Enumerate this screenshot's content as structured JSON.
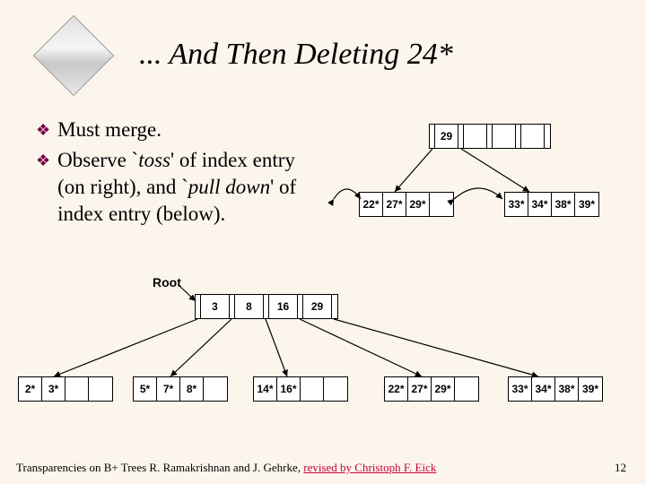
{
  "title": "... And Then Deleting 24*",
  "bullets": [
    {
      "pre": "Must merge.",
      "it": "",
      "post": ""
    },
    {
      "pre": "Observe `",
      "it": "toss",
      "post": "' of index entry (on right), and `",
      "it2": "pull down",
      "post2": "' of index entry (below)."
    }
  ],
  "rootLabel": "Root",
  "topNode": {
    "v0": "29"
  },
  "topLeafL": {
    "v0": "22*",
    "v1": "27*",
    "v2": "29*"
  },
  "topLeafR": {
    "v0": "33*",
    "v1": "34*",
    "v2": "38*",
    "v3": "39*"
  },
  "rootNode": {
    "v0": "3",
    "v1": "8",
    "v2": "16",
    "v3": "29"
  },
  "leaf1": {
    "v0": "2*",
    "v1": "3*"
  },
  "leaf2": {
    "v0": "5*",
    "v1": "7*",
    "v2": "8*"
  },
  "leaf3": {
    "v0": "14*",
    "v1": "16*"
  },
  "leaf4": {
    "v0": "22*",
    "v1": "27*",
    "v2": "29*"
  },
  "leaf5": {
    "v0": "33*",
    "v1": "34*",
    "v2": "38*",
    "v3": "39*"
  },
  "attribution": {
    "plain": "Transparencies on B+ Trees R. Ramakrishnan and J. Gehrke, ",
    "emph": "revised by Christoph F. Eick"
  },
  "pageNum": "12"
}
